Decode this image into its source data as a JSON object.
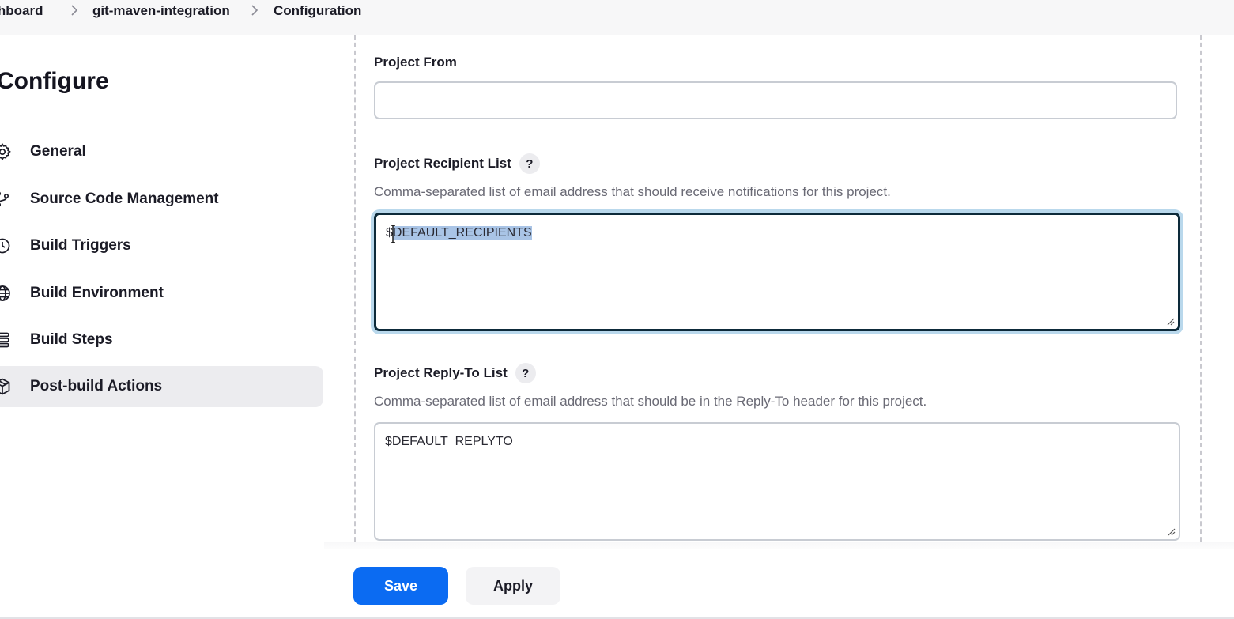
{
  "breadcrumb": {
    "items": [
      "ashboard",
      "git-maven-integration",
      "Configuration"
    ]
  },
  "sidebar": {
    "title": "Configure",
    "items": [
      {
        "label": "General",
        "icon": "gear-icon"
      },
      {
        "label": "Source Code Management",
        "icon": "branch-icon"
      },
      {
        "label": "Build Triggers",
        "icon": "clock-icon"
      },
      {
        "label": "Build Environment",
        "icon": "globe-icon"
      },
      {
        "label": "Build Steps",
        "icon": "list-icon"
      },
      {
        "label": "Post-build Actions",
        "icon": "package-icon",
        "active": true
      }
    ]
  },
  "main": {
    "project_from": {
      "label": "Project From",
      "value": ""
    },
    "recipient_list": {
      "label": "Project Recipient List",
      "help": "?",
      "description": "Comma-separated list of email address that should receive notifications for this project.",
      "value_prefix": "$",
      "value_selected": "DEFAULT_RECIPIENTS"
    },
    "reply_to_list": {
      "label": "Project Reply-To List",
      "help": "?",
      "description": "Comma-separated list of email address that should be in the Reply-To header for this project.",
      "value": "$DEFAULT_REPLYTO"
    }
  },
  "actions": {
    "save_label": "Save",
    "apply_label": "Apply"
  },
  "colors": {
    "primary": "#0b6bf2",
    "focus_ring": "#b9d8ec",
    "selection": "#a9c4e6"
  }
}
